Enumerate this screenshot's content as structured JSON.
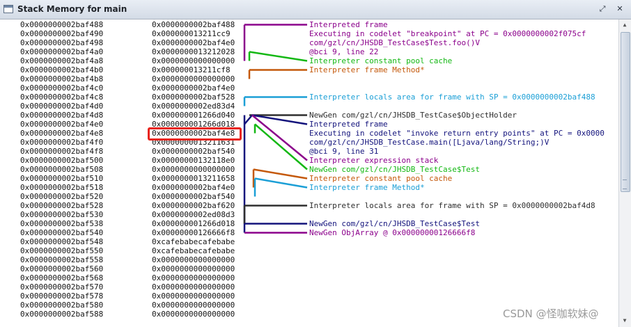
{
  "window": {
    "title": "Stack Memory for main"
  },
  "buttons": {
    "restore": "⤢",
    "close": "✕"
  },
  "rows": [
    {
      "addr": "0x0000000002baf488",
      "value": "0x0000000002baf488"
    },
    {
      "addr": "0x0000000002baf490",
      "value": "0x000000013211cc9"
    },
    {
      "addr": "0x0000000002baf498",
      "value": "0x0000000002baf4e0"
    },
    {
      "addr": "0x0000000002baf4a0",
      "value": "0x0000000013212028"
    },
    {
      "addr": "0x0000000002baf4a8",
      "value": "0x0000000000000000"
    },
    {
      "addr": "0x0000000002baf4b0",
      "value": "0x000000013211cf8"
    },
    {
      "addr": "0x0000000002baf4b8",
      "value": "0x0000000000000000"
    },
    {
      "addr": "0x0000000002baf4c0",
      "value": "0x0000000002baf4e0"
    },
    {
      "addr": "0x0000000002baf4c8",
      "value": "0x0000000002baf528"
    },
    {
      "addr": "0x0000000002baf4d0",
      "value": "0x0000000002ed83d4"
    },
    {
      "addr": "0x0000000002baf4d8",
      "value": "0x000000001266d040"
    },
    {
      "addr": "0x0000000002baf4e0",
      "value": "0x000000001266d018"
    },
    {
      "addr": "0x0000000002baf4e8",
      "value": "0x0000000002baf4e8"
    },
    {
      "addr": "0x0000000002baf4f0",
      "value": "0x0000000013211631"
    },
    {
      "addr": "0x0000000002baf4f8",
      "value": "0x0000000002baf540"
    },
    {
      "addr": "0x0000000002baf500",
      "value": "0x00000000132118e0"
    },
    {
      "addr": "0x0000000002baf508",
      "value": "0x0000000000000000"
    },
    {
      "addr": "0x0000000002baf510",
      "value": "0x0000000013211658"
    },
    {
      "addr": "0x0000000002baf518",
      "value": "0x0000000002baf4e0"
    },
    {
      "addr": "0x0000000002baf520",
      "value": "0x0000000002baf540"
    },
    {
      "addr": "0x0000000002baf528",
      "value": "0x0000000002baf620"
    },
    {
      "addr": "0x0000000002baf530",
      "value": "0x0000000002ed08d3"
    },
    {
      "addr": "0x0000000002baf538",
      "value": "0x000000001266d018"
    },
    {
      "addr": "0x0000000002baf540",
      "value": "0x00000000126666f8"
    },
    {
      "addr": "0x0000000002baf548",
      "value": "0xcafebabecafebabe"
    },
    {
      "addr": "0x0000000002baf550",
      "value": "0xcafebabecafebabe"
    },
    {
      "addr": "0x0000000002baf558",
      "value": "0x0000000000000000"
    },
    {
      "addr": "0x0000000002baf560",
      "value": "0x0000000000000000"
    },
    {
      "addr": "0x0000000002baf568",
      "value": "0x0000000000000000"
    },
    {
      "addr": "0x0000000002baf570",
      "value": "0x0000000000000000"
    },
    {
      "addr": "0x0000000002baf578",
      "value": "0x0000000000000000"
    },
    {
      "addr": "0x0000000002baf580",
      "value": "0x0000000000000000"
    },
    {
      "addr": "0x0000000002baf588",
      "value": "0x0000000000000000"
    }
  ],
  "annotations": [
    {
      "row": 0,
      "text": "Interpreted frame",
      "color": "#8b008b"
    },
    {
      "row": 1,
      "text": "Executing in codelet \"breakpoint\" at PC = 0x0000000002f075cf",
      "color": "#8b008b"
    },
    {
      "row": 2,
      "text": "com/gzl/cn/JHSDB_TestCase$Test.foo()V",
      "color": "#8b008b"
    },
    {
      "row": 3,
      "text": "@bci 9, line 22",
      "color": "#8b008b"
    },
    {
      "row": 4,
      "text": "Interpreter constant pool cache",
      "color": "#14b814"
    },
    {
      "row": 5,
      "text": "Interpreter frame Method*",
      "color": "#c4580a"
    },
    {
      "row": 8,
      "text": "Interpreter locals area for frame with SP = 0x0000000002baf488",
      "color": "#1b9fd6"
    },
    {
      "row": 10,
      "text": "NewGen com/gzl/cn/JHSDB_TestCase$ObjectHolder",
      "color": "#2e2e2e"
    },
    {
      "row": 11,
      "text": "Interpreted frame",
      "color": "#13137c"
    },
    {
      "row": 12,
      "text": "Executing in codelet \"invoke return entry points\" at PC = 0x0000",
      "color": "#13137c"
    },
    {
      "row": 13,
      "text": "com/gzl/cn/JHSDB_TestCase.main([Ljava/lang/String;)V",
      "color": "#13137c"
    },
    {
      "row": 14,
      "text": "@bci 9, line 31",
      "color": "#13137c"
    },
    {
      "row": 15,
      "text": "Interpreter expression stack",
      "color": "#8b008b"
    },
    {
      "row": 16,
      "text": "NewGen com/gzl/cn/JHSDB_TestCase$Test",
      "color": "#14b814"
    },
    {
      "row": 17,
      "text": "Interpreter constant pool cache",
      "color": "#c4580a"
    },
    {
      "row": 18,
      "text": "Interpreter frame Method*",
      "color": "#1b9fd6"
    },
    {
      "row": 20,
      "text": "Interpreter locals area for frame with SP = 0x0000000002baf4d8",
      "color": "#2e2e2e"
    },
    {
      "row": 22,
      "text": "NewGen com/gzl/cn/JHSDB_TestCase$Test",
      "color": "#13137c"
    },
    {
      "row": 23,
      "text": "NewGen ObjArray @ 0x00000000126666f8",
      "color": "#8b008b"
    }
  ],
  "watermark": "CSDN @怪咖软妹@"
}
